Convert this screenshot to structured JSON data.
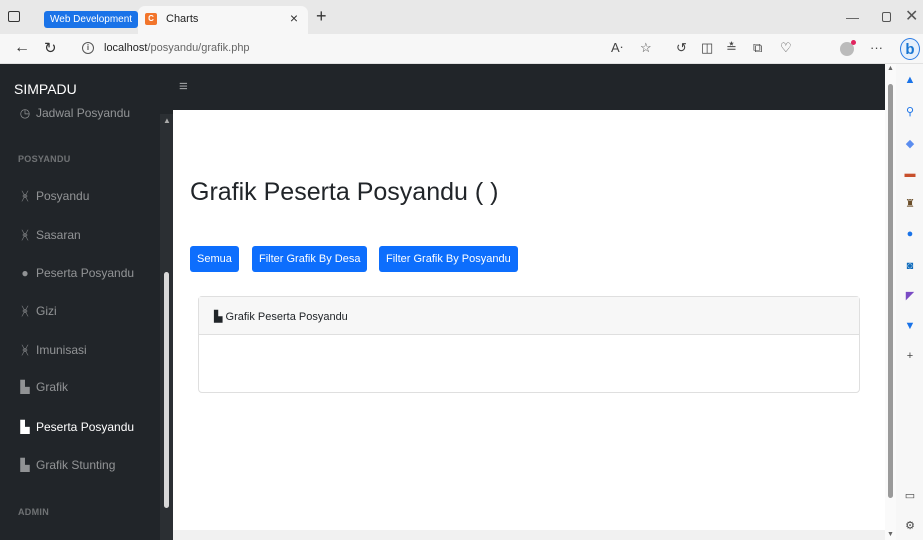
{
  "browser": {
    "tab_group_label": "Web Development",
    "tab_favicon": "C",
    "tab_title": "Charts",
    "tab_close": "×",
    "new_tab": "+",
    "url_host": "localhost",
    "url_path": "/posyandu/grafik.php",
    "icons": [
      "tab-actions-icon",
      "back-icon",
      "reload-icon",
      "info-icon",
      "read-aloud-icon",
      "favorite-icon",
      "extensions-icon",
      "split-screen-icon",
      "favorites-icon",
      "collections-icon",
      "heart-icon",
      "profile-icon",
      "more-icon",
      "bing-chat-icon"
    ]
  },
  "app": {
    "brand": "SIMPADU",
    "hamburger": "≡",
    "sidebar": {
      "partial_item": "Jadwal Posyandu",
      "heading_posyandu": "POSYANDU",
      "items": [
        {
          "label": "Posyandu",
          "icon": "stethoscope-icon"
        },
        {
          "label": "Sasaran",
          "icon": "stethoscope-icon"
        },
        {
          "label": "Peserta Posyandu",
          "icon": "user-icon"
        },
        {
          "label": "Gizi",
          "icon": "stethoscope-icon"
        },
        {
          "label": "Imunisasi",
          "icon": "stethoscope-icon"
        },
        {
          "label": "Grafik",
          "icon": "chart-area-icon"
        },
        {
          "label": "Peserta Posyandu",
          "icon": "chart-area-icon",
          "active": true
        },
        {
          "label": "Grafik Stunting",
          "icon": "chart-area-icon"
        }
      ],
      "heading_admin": "ADMIN"
    },
    "main": {
      "title": "Grafik Peserta Posyandu ( )",
      "buttons": [
        "Semua",
        "Filter Grafik By Desa",
        "Filter Grafik By Posyandu"
      ],
      "card_title": "Grafik Peserta Posyandu"
    }
  },
  "colors": {
    "sidebar_bg": "#212529",
    "primary": "#0d6efd",
    "tab_group": "#1a73e8"
  }
}
